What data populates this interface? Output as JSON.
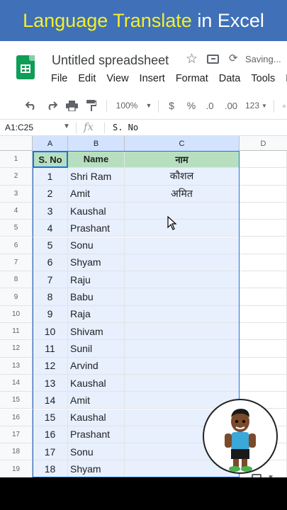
{
  "banner": {
    "title_highlight": "Language Translate",
    "title_rest": "in Excel"
  },
  "doc": {
    "title": "Untitled spreadsheet",
    "status": "Saving..."
  },
  "menu": [
    "File",
    "Edit",
    "View",
    "Insert",
    "Format",
    "Data",
    "Tools",
    "E"
  ],
  "toolbar": {
    "zoom": "100%",
    "currency": "$",
    "percent": "%",
    "dec_decrease": ".0",
    "dec_increase": ".00",
    "more_formats": "123"
  },
  "formula_bar": {
    "name_box": "A1:C25",
    "fx_label": "fx",
    "value": "S. No"
  },
  "columns": [
    "A",
    "B",
    "C",
    "D"
  ],
  "header_row": {
    "row": "1",
    "a": "S. No",
    "b": "Name",
    "c": "नाम"
  },
  "rows": [
    {
      "row": "2",
      "a": "1",
      "b": "Shri Ram",
      "c": "कौशल"
    },
    {
      "row": "3",
      "a": "2",
      "b": "Amit",
      "c": "अमित"
    },
    {
      "row": "4",
      "a": "3",
      "b": "Kaushal",
      "c": ""
    },
    {
      "row": "5",
      "a": "4",
      "b": "Prashant",
      "c": ""
    },
    {
      "row": "6",
      "a": "5",
      "b": "Sonu",
      "c": ""
    },
    {
      "row": "7",
      "a": "6",
      "b": "Shyam",
      "c": ""
    },
    {
      "row": "8",
      "a": "7",
      "b": "Raju",
      "c": ""
    },
    {
      "row": "9",
      "a": "8",
      "b": "Babu",
      "c": ""
    },
    {
      "row": "10",
      "a": "9",
      "b": "Raja",
      "c": ""
    },
    {
      "row": "11",
      "a": "10",
      "b": "Shivam",
      "c": ""
    },
    {
      "row": "12",
      "a": "11",
      "b": "Sunil",
      "c": ""
    },
    {
      "row": "13",
      "a": "12",
      "b": "Arvind",
      "c": ""
    },
    {
      "row": "14",
      "a": "13",
      "b": "Kaushal",
      "c": ""
    },
    {
      "row": "15",
      "a": "14",
      "b": "Amit",
      "c": ""
    },
    {
      "row": "16",
      "a": "15",
      "b": "Kaushal",
      "c": ""
    },
    {
      "row": "17",
      "a": "16",
      "b": "Prashant",
      "c": ""
    },
    {
      "row": "18",
      "a": "17",
      "b": "Sonu",
      "c": ""
    },
    {
      "row": "19",
      "a": "18",
      "b": "Shyam",
      "c": ""
    }
  ],
  "colors": {
    "banner_bg": "#3f70b8",
    "banner_highlight": "#f4ef2b",
    "header_fill": "#b7dfbf",
    "selection_fill": "#e8f0fe",
    "selection_border": "#1a73e8"
  }
}
